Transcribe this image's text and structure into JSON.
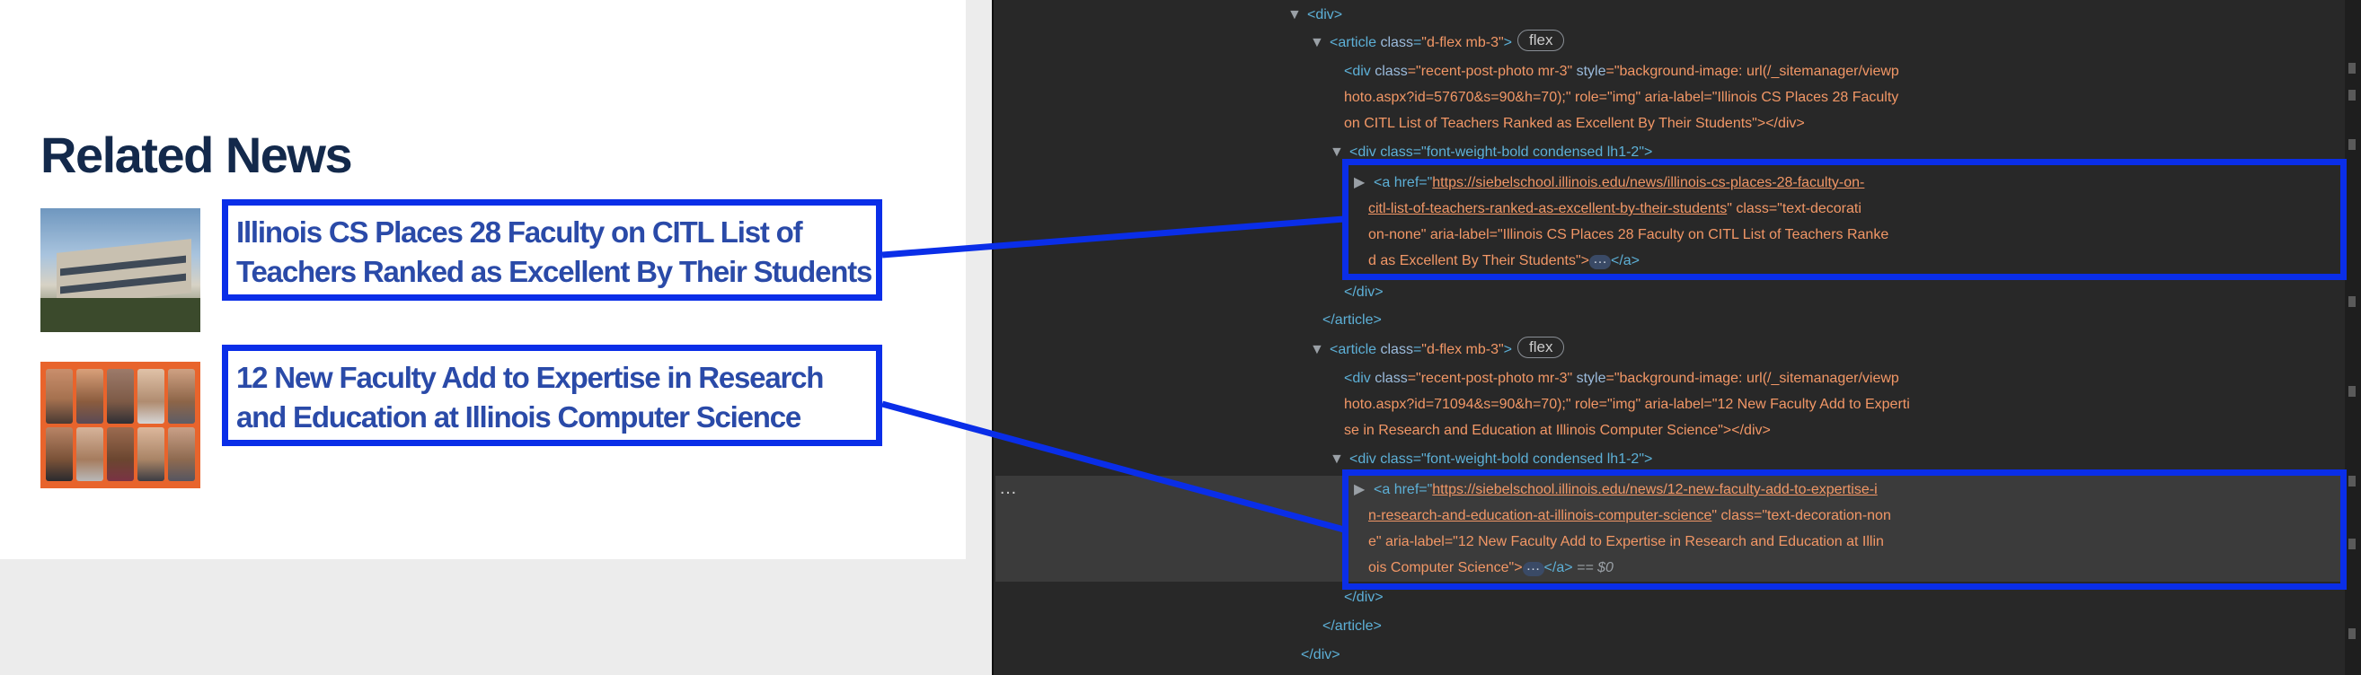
{
  "webpage": {
    "section_title": "Related News",
    "news": [
      {
        "headline": "Illinois CS Places 28 Faculty on CITL List of Teachers Ranked as Excellent By Their Students"
      },
      {
        "headline": "12 New Faculty Add to Expertise in Research and Education at Illinois Computer Science"
      }
    ]
  },
  "devtools": {
    "lines": {
      "l1_tag": "<div>",
      "l2_tag_open": "<article",
      "l2_attr": "class",
      "l2_val": "\"d-flex mb-3\"",
      "l2_close": ">",
      "l2_badge": "flex",
      "l3_a": "<div ",
      "l3_b": "class",
      "l3_c": "=\"recent-post-photo mr-3\" ",
      "l3_d": "style",
      "l3_e": "=\"background-image: url(/_sitemanager/viewp",
      "l4": "hoto.aspx?id=57670&s=90&h=70);\" role=\"img\" aria-label=\"Illinois CS Places 28 Faculty",
      "l5": "on CITL List of Teachers Ranked as Excellent By Their Students\"></div>",
      "l6": "<div class=\"font-weight-bold condensed lh1-2\">",
      "l7_a": "<a href=\"",
      "l7_url": "https://siebelschool.illinois.edu/news/illinois-cs-places-28-faculty-on-",
      "l8_url": "citl-list-of-teachers-ranked-as-excellent-by-their-students",
      "l8_b": "\" class=\"text-decorati",
      "l9": "on-none\" aria-label=\"Illinois CS Places 28 Faculty on CITL List of Teachers Ranke",
      "l10_a": "d as Excellent By Their Students\">",
      "l10_ell": "…",
      "l10_b": "</a>",
      "l11": "</div>",
      "l12": "</article>",
      "l13_tag_open": "<article",
      "l13_attr": "class",
      "l13_val": "\"d-flex mb-3\"",
      "l13_close": ">",
      "l13_badge": "flex",
      "l14_a": "<div ",
      "l14_b": "class",
      "l14_c": "=\"recent-post-photo mr-3\" ",
      "l14_d": "style",
      "l14_e": "=\"background-image: url(/_sitemanager/viewp",
      "l15": "hoto.aspx?id=71094&s=90&h=70);\" role=\"img\" aria-label=\"12 New Faculty Add to Experti",
      "l16": "se in Research and Education at Illinois Computer Science\"></div>",
      "l17": "<div class=\"font-weight-bold condensed lh1-2\">",
      "l18_a": "<a href=\"",
      "l18_url": "https://siebelschool.illinois.edu/news/12-new-faculty-add-to-expertise-i",
      "l19_url": "n-research-and-education-at-illinois-computer-science",
      "l19_b": "\" class=\"text-decoration-non",
      "l20": "e\" aria-label=\"12 New Faculty Add to Expertise in Research and Education at Illin",
      "l21_a": "ois Computer Science\">",
      "l21_ell": "…",
      "l21_b": "</a>",
      "l21_eq": " == $0",
      "l22": "</div>",
      "l23": "</article>",
      "l24": "</div>",
      "selected_dots": "…"
    }
  },
  "colors": {
    "highlight": "#0a2ee8",
    "title": "#13294b",
    "link": "#2a4aa8"
  }
}
